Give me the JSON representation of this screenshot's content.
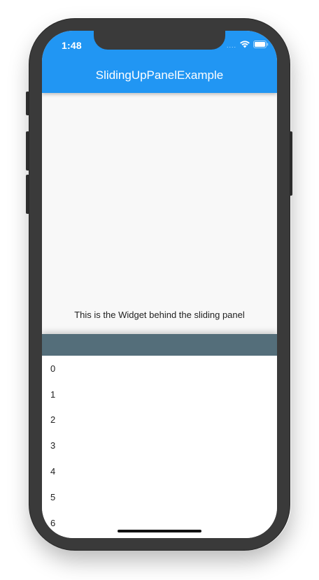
{
  "status_bar": {
    "time": "1:48",
    "signal_dots": "....",
    "wifi_icon": "wifi-icon",
    "battery_icon": "battery-icon"
  },
  "app_bar": {
    "title": "SlidingUpPanelExample",
    "color": "#2196f3"
  },
  "body": {
    "text": "This is the Widget behind the sliding panel",
    "background": "#f8f8f8"
  },
  "panel": {
    "header_color": "#546e7a",
    "items": [
      "0",
      "1",
      "2",
      "3",
      "4",
      "5",
      "6"
    ]
  }
}
